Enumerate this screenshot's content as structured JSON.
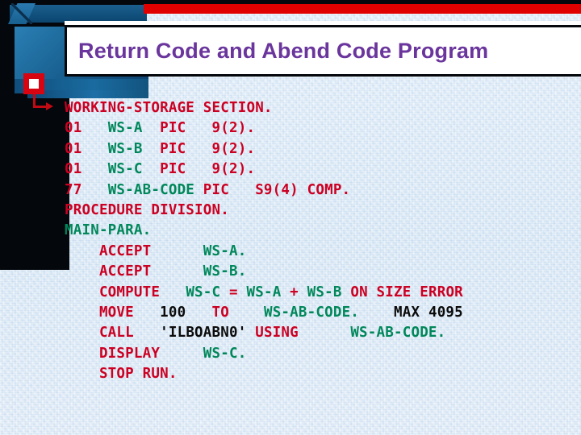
{
  "slide": {
    "title": "Return Code and Abend Code Program",
    "bullet_marker": "square-bullet",
    "accent_colors": {
      "title_purple": "#6a359c",
      "rule_red": "#e00000",
      "bullet_red": "#d70512",
      "keyword_red": "#cc0022",
      "identifier_green": "#00875a",
      "literal_black": "#0b0b0b",
      "background_blue": "#dde9f6",
      "frame_navy": "#04070c",
      "decor_blue": "#1a6394"
    }
  },
  "code": {
    "language": "COBOL",
    "lines": [
      {
        "id": "line-1",
        "text": "WORKING-STORAGE SECTION.",
        "tokens": [
          {
            "t": "WORKING-STORAGE SECTION.",
            "c": "key"
          }
        ]
      },
      {
        "id": "line-2",
        "text": "01   WS-A  PIC   9(2).",
        "tokens": [
          {
            "t": "01   ",
            "c": "key"
          },
          {
            "t": "WS-A",
            "c": "id"
          },
          {
            "t": "  PIC   9(2).",
            "c": "key"
          }
        ]
      },
      {
        "id": "line-3",
        "text": "01   WS-B  PIC   9(2).",
        "tokens": [
          {
            "t": "01   ",
            "c": "key"
          },
          {
            "t": "WS-B",
            "c": "id"
          },
          {
            "t": "  PIC   9(2).",
            "c": "key"
          }
        ]
      },
      {
        "id": "line-4",
        "text": "01   WS-C  PIC   9(2).",
        "tokens": [
          {
            "t": "01   ",
            "c": "key"
          },
          {
            "t": "WS-C",
            "c": "id"
          },
          {
            "t": "  PIC   9(2).",
            "c": "key"
          }
        ]
      },
      {
        "id": "line-5",
        "text": "77   WS-AB-CODE PIC   S9(4) COMP.",
        "tokens": [
          {
            "t": "77   ",
            "c": "key"
          },
          {
            "t": "WS-AB-CODE",
            "c": "id"
          },
          {
            "t": " PIC   S9(4) COMP.",
            "c": "key"
          }
        ]
      },
      {
        "id": "line-6",
        "text": "PROCEDURE DIVISION.",
        "tokens": [
          {
            "t": "PROCEDURE DIVISION.",
            "c": "key"
          }
        ]
      },
      {
        "id": "line-7",
        "text": "MAIN-PARA.",
        "tokens": [
          {
            "t": "MAIN-PARA.",
            "c": "id"
          }
        ]
      },
      {
        "id": "line-8",
        "text": "    ACCEPT      WS-A.",
        "tokens": [
          {
            "t": "    ACCEPT      ",
            "c": "key"
          },
          {
            "t": "WS-A.",
            "c": "id"
          }
        ]
      },
      {
        "id": "line-9",
        "text": "    ACCEPT      WS-B.",
        "tokens": [
          {
            "t": "    ACCEPT      ",
            "c": "key"
          },
          {
            "t": "WS-B.",
            "c": "id"
          }
        ]
      },
      {
        "id": "line-10",
        "text": "    COMPUTE   WS-C = WS-A + WS-B ON SIZE ERROR",
        "tokens": [
          {
            "t": "    COMPUTE   ",
            "c": "key"
          },
          {
            "t": "WS-C",
            "c": "id"
          },
          {
            "t": " = ",
            "c": "key"
          },
          {
            "t": "WS-A",
            "c": "id"
          },
          {
            "t": " + ",
            "c": "key"
          },
          {
            "t": "WS-B",
            "c": "id"
          },
          {
            "t": " ON SIZE ERROR",
            "c": "key"
          }
        ]
      },
      {
        "id": "line-11",
        "text": "    MOVE   100   TO    WS-AB-CODE.    MAX 4095",
        "tokens": [
          {
            "t": "    MOVE   ",
            "c": "key"
          },
          {
            "t": "100",
            "c": "lit"
          },
          {
            "t": "   TO    ",
            "c": "key"
          },
          {
            "t": "WS-AB-CODE.",
            "c": "id"
          },
          {
            "t": "    ",
            "c": "key"
          },
          {
            "t": "MAX 4095",
            "c": "lit"
          }
        ]
      },
      {
        "id": "line-12",
        "text": "    CALL   'ILBOABN0' USING      WS-AB-CODE.",
        "tokens": [
          {
            "t": "    CALL   ",
            "c": "key"
          },
          {
            "t": "'ILBOABN0'",
            "c": "lit"
          },
          {
            "t": " USING      ",
            "c": "key"
          },
          {
            "t": "WS-AB-CODE.",
            "c": "id"
          }
        ]
      },
      {
        "id": "line-13",
        "text": "    DISPLAY     WS-C.",
        "tokens": [
          {
            "t": "    DISPLAY     ",
            "c": "key"
          },
          {
            "t": "WS-C.",
            "c": "id"
          }
        ]
      },
      {
        "id": "line-14",
        "text": "    STOP RUN.",
        "tokens": [
          {
            "t": "    STOP RUN.",
            "c": "key"
          }
        ]
      }
    ]
  }
}
